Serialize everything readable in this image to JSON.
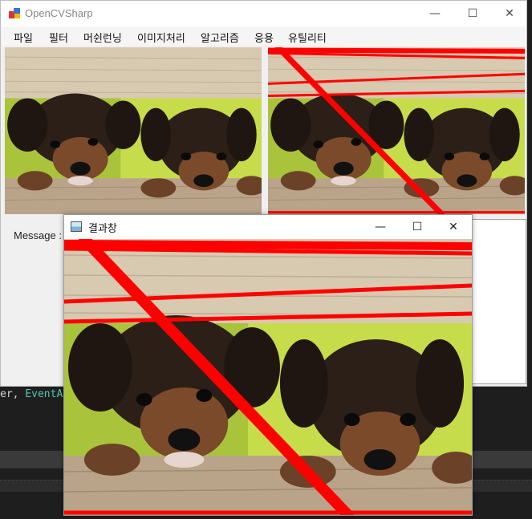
{
  "main_window": {
    "title": "OpenCVSharp",
    "controls": {
      "minimize": "—",
      "maximize": "☐",
      "close": "✕"
    },
    "menu": [
      "파일",
      "필터",
      "머쉰런닝",
      "이미지처리",
      "알고리즘",
      "응용",
      "유틸리티"
    ],
    "message_label": "Message :"
  },
  "result_window": {
    "title": "결과창",
    "controls": {
      "minimize": "—",
      "maximize": "☐",
      "close": "✕"
    }
  },
  "ide": {
    "code_prefix": "er, ",
    "code_type": "EventArg"
  },
  "colors": {
    "line_color": "#ff0000"
  }
}
